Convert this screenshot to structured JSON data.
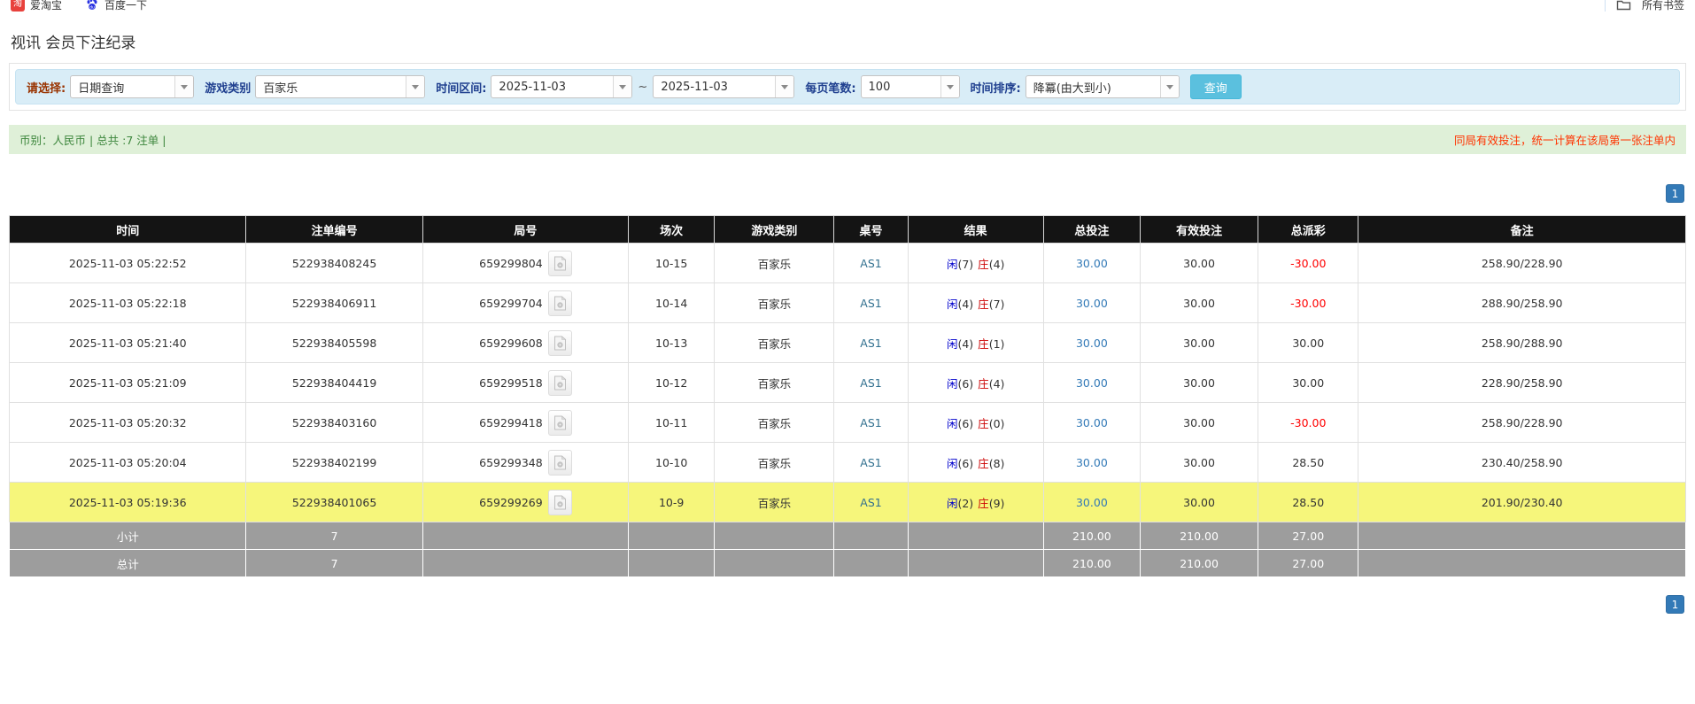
{
  "browser_bar": {
    "bookmarks": [
      {
        "label": "爱淘宝",
        "icon": "taobao-icon"
      },
      {
        "label": "百度一下",
        "icon": "baidu-icon"
      }
    ],
    "all_bookmarks_label": "所有书签"
  },
  "page_title": "视讯 会员下注纪录",
  "filters": {
    "select_label": "请选择:",
    "select_value": "日期查询",
    "game_type_label": "游戏类别",
    "game_type_value": "百家乐",
    "date_range_label": "时间区间:",
    "date_from": "2025-11-03",
    "range_separator": "~",
    "date_to": "2025-11-03",
    "page_size_label": "每页笔数:",
    "page_size_value": "100",
    "sort_label": "时间排序:",
    "sort_value": "降冪(由大到小)",
    "search_button_label": "查询"
  },
  "summary_bar": {
    "left_text": "币别：人民币 | 总共 :7 注单 |",
    "right_text": "同局有效投注，统一计算在该局第一张注单内"
  },
  "pagination": {
    "current_page": "1"
  },
  "table": {
    "headers": [
      "时间",
      "注单编号",
      "局号",
      "场次",
      "游戏类别",
      "桌号",
      "结果",
      "总投注",
      "有效投注",
      "总派彩",
      "备注"
    ],
    "rows": [
      {
        "time": "2025-11-03 05:22:52",
        "bet_id": "522938408245",
        "round_id": "659299804",
        "session": "10-15",
        "game": "百家乐",
        "table_no": "AS1",
        "result": {
          "player": "闲",
          "player_score": "(7)",
          "banker": "庄",
          "banker_score": "(4)"
        },
        "total_bet": "30.00",
        "valid_bet": "30.00",
        "payout": "-30.00",
        "remark": "258.90/228.90",
        "highlight": false
      },
      {
        "time": "2025-11-03 05:22:18",
        "bet_id": "522938406911",
        "round_id": "659299704",
        "session": "10-14",
        "game": "百家乐",
        "table_no": "AS1",
        "result": {
          "player": "闲",
          "player_score": "(4)",
          "banker": "庄",
          "banker_score": "(7)"
        },
        "total_bet": "30.00",
        "valid_bet": "30.00",
        "payout": "-30.00",
        "remark": "288.90/258.90",
        "highlight": false
      },
      {
        "time": "2025-11-03 05:21:40",
        "bet_id": "522938405598",
        "round_id": "659299608",
        "session": "10-13",
        "game": "百家乐",
        "table_no": "AS1",
        "result": {
          "player": "闲",
          "player_score": "(4)",
          "banker": "庄",
          "banker_score": "(1)"
        },
        "total_bet": "30.00",
        "valid_bet": "30.00",
        "payout": "30.00",
        "remark": "258.90/288.90",
        "highlight": false
      },
      {
        "time": "2025-11-03 05:21:09",
        "bet_id": "522938404419",
        "round_id": "659299518",
        "session": "10-12",
        "game": "百家乐",
        "table_no": "AS1",
        "result": {
          "player": "闲",
          "player_score": "(6)",
          "banker": "庄",
          "banker_score": "(4)"
        },
        "total_bet": "30.00",
        "valid_bet": "30.00",
        "payout": "30.00",
        "remark": "228.90/258.90",
        "highlight": false
      },
      {
        "time": "2025-11-03 05:20:32",
        "bet_id": "522938403160",
        "round_id": "659299418",
        "session": "10-11",
        "game": "百家乐",
        "table_no": "AS1",
        "result": {
          "player": "闲",
          "player_score": "(6)",
          "banker": "庄",
          "banker_score": "(0)"
        },
        "total_bet": "30.00",
        "valid_bet": "30.00",
        "payout": "-30.00",
        "remark": "258.90/228.90",
        "highlight": false
      },
      {
        "time": "2025-11-03 05:20:04",
        "bet_id": "522938402199",
        "round_id": "659299348",
        "session": "10-10",
        "game": "百家乐",
        "table_no": "AS1",
        "result": {
          "player": "闲",
          "player_score": "(6)",
          "banker": "庄",
          "banker_score": "(8)"
        },
        "total_bet": "30.00",
        "valid_bet": "30.00",
        "payout": "28.50",
        "remark": "230.40/258.90",
        "highlight": false
      },
      {
        "time": "2025-11-03 05:19:36",
        "bet_id": "522938401065",
        "round_id": "659299269",
        "session": "10-9",
        "game": "百家乐",
        "table_no": "AS1",
        "result": {
          "player": "闲",
          "player_score": "(2)",
          "banker": "庄",
          "banker_score": "(9)"
        },
        "total_bet": "30.00",
        "valid_bet": "30.00",
        "payout": "28.50",
        "remark": "201.90/230.40",
        "highlight": true
      }
    ],
    "subtotal_row": {
      "label": "小计",
      "count": "7",
      "total_bet": "210.00",
      "valid_bet": "210.00",
      "payout": "27.00"
    },
    "total_row": {
      "label": "总计",
      "count": "7",
      "total_bet": "210.00",
      "valid_bet": "210.00",
      "payout": "27.00"
    }
  },
  "icons": {
    "video_replay": "video-file-icon",
    "dropdown": "chevron-down-icon",
    "folder": "folder-icon",
    "taobao": "taobao-icon",
    "baidu": "baidu-icon"
  },
  "colors": {
    "accent_blue": "#337ab7",
    "query_button": "#5bc0de",
    "filter_bar_bg": "#d9edf7",
    "success_bg": "#dff0d8",
    "success_text": "#3c863c",
    "warning_text": "#ff3300",
    "header_bg": "#141414",
    "highlight_row": "#f6f67b",
    "summary_row_bg": "#9d9d9d",
    "player_blue": "#0000cc",
    "banker_red": "#cc0000",
    "negative_red": "#ff0000"
  }
}
